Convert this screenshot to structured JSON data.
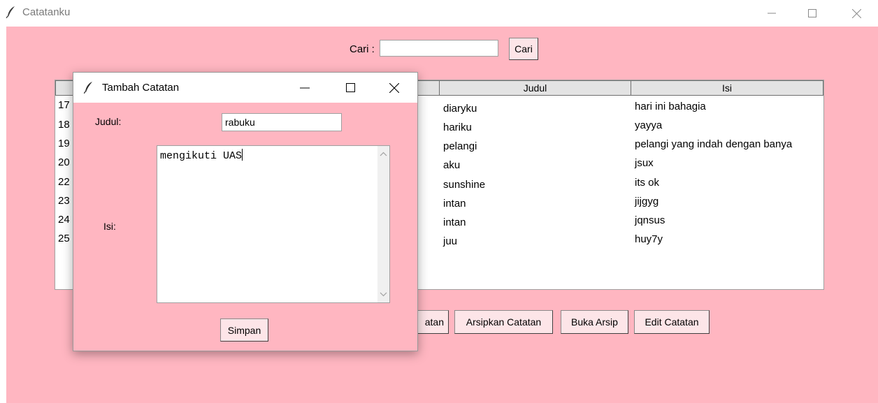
{
  "app": {
    "title": "Catatanku",
    "icon": "feather-icon"
  },
  "window_controls": {
    "minimize": "minimize-icon",
    "maximize": "maximize-icon",
    "close": "close-icon"
  },
  "search": {
    "label": "Cari :",
    "value": "",
    "button": "Cari"
  },
  "table": {
    "columns": [
      "Judul",
      "Isi"
    ],
    "rows": [
      {
        "id": "17",
        "judul": "diaryku",
        "isi": "hari ini bahagia"
      },
      {
        "id": "18",
        "judul": "hariku",
        "isi": "yayya"
      },
      {
        "id": "19",
        "judul": "pelangi",
        "isi": "pelangi yang indah dengan banya"
      },
      {
        "id": "20",
        "judul": "aku",
        "isi": "jsux"
      },
      {
        "id": "22",
        "judul": "sunshine",
        "isi": "its ok"
      },
      {
        "id": "23",
        "judul": "intan",
        "isi": "jijgyg"
      },
      {
        "id": "24",
        "judul": "intan",
        "isi": "jqnsus"
      },
      {
        "id": "25",
        "judul": "juu",
        "isi": "huy7y"
      }
    ]
  },
  "actions": {
    "partial_button": "atan",
    "archive_button": "Arsipkan Catatan",
    "open_archive_button": "Buka Arsip",
    "edit_button": "Edit Catatan"
  },
  "dialog": {
    "title": "Tambah Catatan",
    "judul_label": "Judul:",
    "judul_value": "rabuku",
    "isi_label": "Isi:",
    "isi_value": "mengikuti UAS",
    "save_button": "Simpan"
  },
  "colors": {
    "background": "#ffb6c1",
    "button": "#fde5e8",
    "header": "#e3e3e3"
  }
}
